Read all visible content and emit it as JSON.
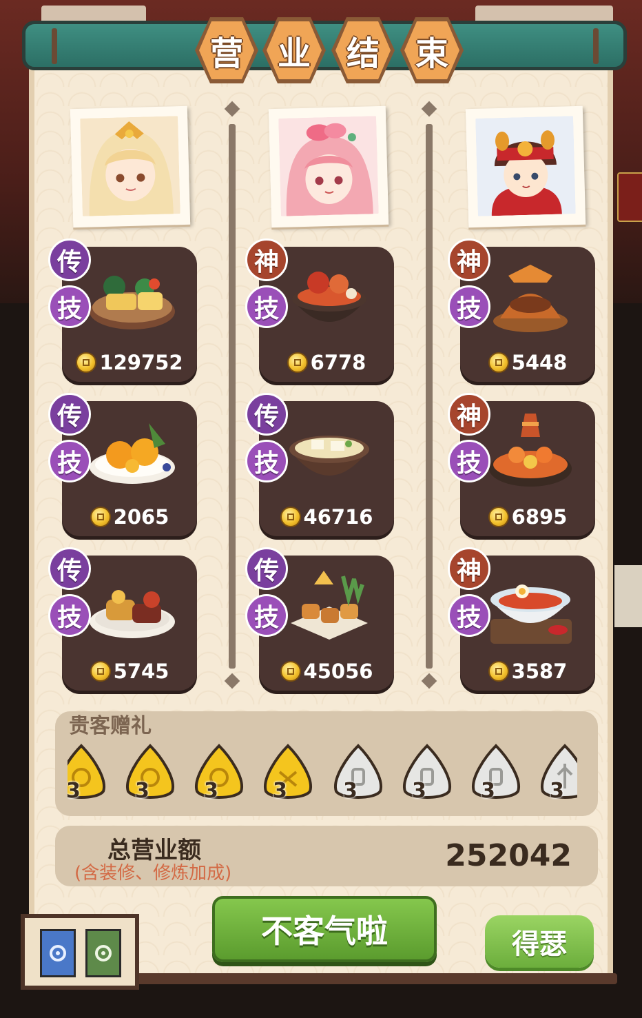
{
  "title_chars": [
    "营",
    "业",
    "结",
    "束"
  ],
  "columns": [
    {
      "dishes": [
        {
          "rank": "传",
          "skill": "技",
          "value": "129752"
        },
        {
          "rank": "传",
          "skill": "技",
          "value": "2065"
        },
        {
          "rank": "传",
          "skill": "技",
          "value": "5745"
        }
      ]
    },
    {
      "dishes": [
        {
          "rank": "神",
          "skill": "技",
          "value": "6778"
        },
        {
          "rank": "传",
          "skill": "技",
          "value": "46716"
        },
        {
          "rank": "传",
          "skill": "技",
          "value": "45056"
        }
      ]
    },
    {
      "dishes": [
        {
          "rank": "神",
          "skill": "技",
          "value": "5448"
        },
        {
          "rank": "神",
          "skill": "技",
          "value": "6895"
        },
        {
          "rank": "神",
          "skill": "技",
          "value": "3587"
        }
      ]
    }
  ],
  "gifts": {
    "title": "贵客赠礼",
    "items": [
      {
        "color": "gold",
        "count": "3"
      },
      {
        "color": "gold",
        "count": "3"
      },
      {
        "color": "gold",
        "count": "3"
      },
      {
        "color": "gold",
        "count": "3"
      },
      {
        "color": "silver",
        "count": "3"
      },
      {
        "color": "silver",
        "count": "3"
      },
      {
        "color": "silver",
        "count": "3"
      },
      {
        "color": "silver",
        "count": "3"
      }
    ]
  },
  "total": {
    "label": "总营业额",
    "note": "(含装修、修炼加成)",
    "value": "252042"
  },
  "buttons": {
    "confirm": "不客气啦",
    "side": "得瑟"
  },
  "colors": {
    "rank_chuan": "#7a3f9e",
    "rank_shen": "#a6452d",
    "primary_button": "#6cae3c"
  }
}
